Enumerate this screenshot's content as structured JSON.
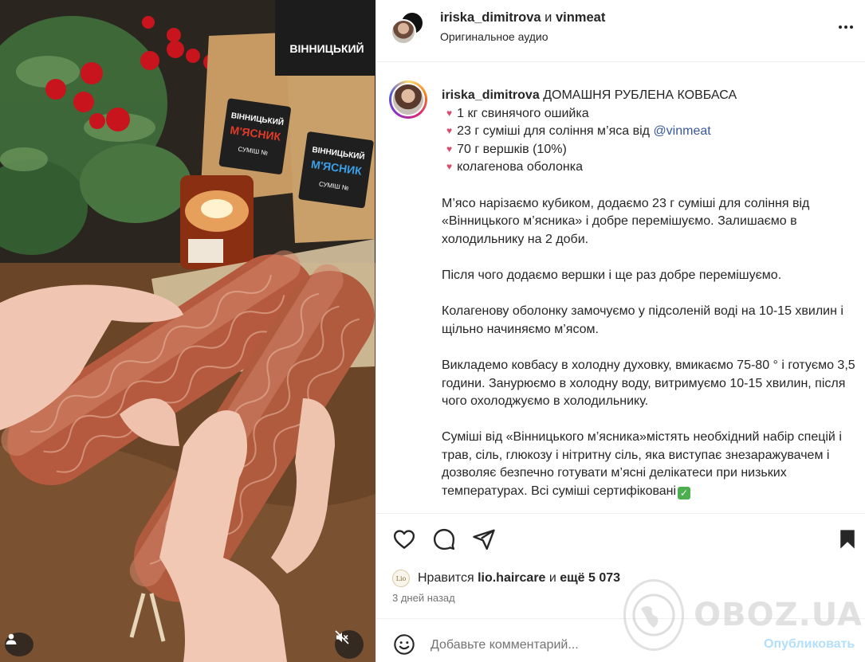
{
  "colors": {
    "accent_link": "#385898",
    "post_button": "#b2dffc",
    "bullet_heart": "#d94a6b",
    "secondary_text": "#737373"
  },
  "media": {
    "icons": {
      "user": "user-icon",
      "mute": "speaker-muted-icon"
    },
    "packaging_label_line1": "ВІННИЦЬКИЙ",
    "packaging_label_line2": "М'ЯСНИК",
    "packaging_small_label": "СУМІШ №"
  },
  "header": {
    "user1": "iriska_dimitrova",
    "and_word": "и",
    "user2": "vinmeat",
    "audio": "Оригинальное аудио",
    "more_icon": "more-dots-icon"
  },
  "caption": {
    "username": "iriska_dimitrova",
    "title": "ДОМАШНЯ РУБЛЕНА КОВБАСА",
    "ingredients": [
      {
        "bullet": "♥",
        "text": "1 кг свинячого ошийка",
        "mention": ""
      },
      {
        "bullet": "♥",
        "text": "23 г суміші для соління м’яса від ",
        "mention": "@vinmeat"
      },
      {
        "bullet": "♥",
        "text": "70 г вершків (10%)",
        "mention": ""
      },
      {
        "bullet": "♥",
        "text": "колагенова оболонка",
        "mention": ""
      }
    ],
    "paragraphs": [
      "М’ясо нарізаємо кубиком, додаємо 23 г суміші для соління від «Вінницького м’ясника» і добре перемішуємо. Залишаємо в холодильнику на 2 доби.",
      "Після чого додаємо вершки і ще раз добре перемішуємо.",
      "Колагенову оболонку замочуємо у підсоленій воді на 10-15 хвилин і щільно начиняємо м’ясом.",
      "Викладемо ковбасу в холодну духовку, вмикаємо 75-80 ° і готуємо 3,5 години. Занурюємо в холодну воду, витримуємо 10-15 хвилин, після чого охолоджуємо в холодильнику.",
      "Суміші від «Вінницького м’ясника»містять необхідний набір спецій і трав, сіль, глюкозу і нітритну сіль, яка виступає знезаражувачем і дозволяє безпечно готувати м’ясні делікатеси при низьких температурах. Всі суміші сертифіковані"
    ],
    "check_emoji": "✓"
  },
  "actions": {
    "like_icon": "heart-icon",
    "comment_icon": "comment-icon",
    "share_icon": "share-icon",
    "save_icon": "bookmark-icon"
  },
  "likes": {
    "prefix": "Нравится",
    "liker": "lio.haircare",
    "middle": "и",
    "rest": "ещё 5 073",
    "liker_avatar_text": "Lio"
  },
  "time": "3 дней назад",
  "comment": {
    "placeholder": "Добавьте комментарий...",
    "post_label": "Опубликовать",
    "emoji_icon": "smiley-icon"
  },
  "watermark": "OBOZ.UA"
}
